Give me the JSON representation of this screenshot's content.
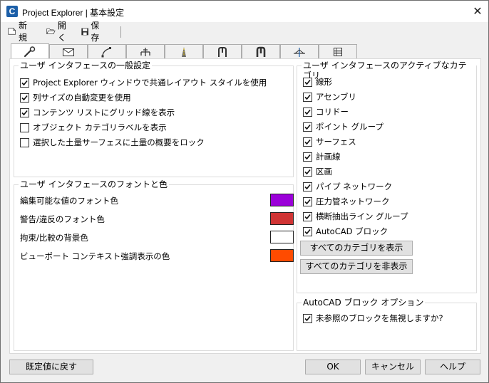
{
  "window": {
    "title": "Project Explorer | 基本設定",
    "app_icon_letter": "C",
    "close_glyph": "✕"
  },
  "toolbar": {
    "new_label": "新規",
    "open_label": "開く",
    "save_label": "保存"
  },
  "tabs": [
    {
      "icon": "wrench-icon",
      "active": true
    },
    {
      "icon": "envelope-icon"
    },
    {
      "icon": "alignment-curve-icon"
    },
    {
      "icon": "assembly-icon"
    },
    {
      "icon": "corridor-icon"
    },
    {
      "icon": "pipe-network-icon"
    },
    {
      "icon": "pressure-network-icon"
    },
    {
      "icon": "sample-line-icon"
    },
    {
      "icon": "table-icon"
    }
  ],
  "general": {
    "title": "ユーザ インタフェースの一般設定",
    "options": [
      {
        "label": "Project Explorer ウィンドウで共通レイアウト スタイルを使用",
        "checked": true
      },
      {
        "label": "列サイズの自動変更を使用",
        "checked": true
      },
      {
        "label": "コンテンツ リストにグリッド線を表示",
        "checked": true
      },
      {
        "label": "オブジェクト カテゴリラベルを表示",
        "checked": false
      },
      {
        "label": "選択した土量サーフェスに土量の概要をロック",
        "checked": false
      }
    ]
  },
  "fonts_colors": {
    "title": "ユーザ インタフェースのフォントと色",
    "items": [
      {
        "label": "編集可能な値のフォント色",
        "color": "#9b00d9"
      },
      {
        "label": "警告/違反のフォント色",
        "color": "#d03434"
      },
      {
        "label": "拘束/比較の背景色",
        "color": "#ffffff"
      },
      {
        "label": "ビューポート コンテキスト強調表示の色",
        "color": "#ff4b00"
      }
    ]
  },
  "categories": {
    "title": "ユーザ インタフェースのアクティブなカテゴリ",
    "items": [
      {
        "label": "線形",
        "checked": true
      },
      {
        "label": "アセンブリ",
        "checked": true
      },
      {
        "label": "コリドー",
        "checked": true
      },
      {
        "label": "ポイント グループ",
        "checked": true
      },
      {
        "label": "サーフェス",
        "checked": true
      },
      {
        "label": "計画線",
        "checked": true
      },
      {
        "label": "区画",
        "checked": true
      },
      {
        "label": "パイプ ネットワーク",
        "checked": true
      },
      {
        "label": "圧力管ネットワーク",
        "checked": true
      },
      {
        "label": "横断抽出ライン グループ",
        "checked": true
      },
      {
        "label": "AutoCAD ブロック",
        "checked": true
      }
    ],
    "show_all_label": "すべてのカテゴリを表示",
    "hide_all_label": "すべてのカテゴリを非表示"
  },
  "block_options": {
    "title": "AutoCAD ブロック オプション",
    "option": {
      "label": "未参照のブロックを無視しますか?",
      "checked": true
    }
  },
  "footer": {
    "reset_label": "既定値に戻す",
    "ok_label": "OK",
    "cancel_label": "キャンセル",
    "help_label": "ヘルプ"
  }
}
